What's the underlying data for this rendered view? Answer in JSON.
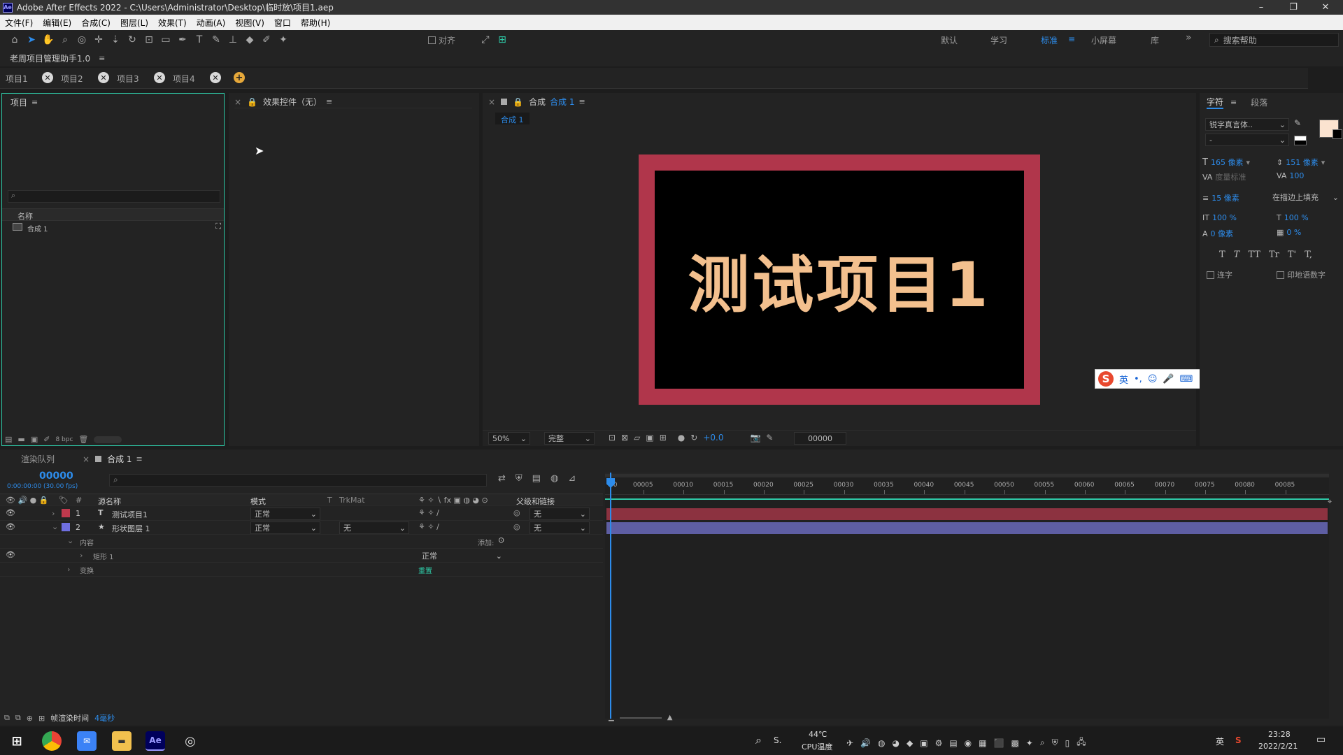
{
  "titlebar": {
    "logo": "Ae",
    "title": "Adobe After Effects 2022 - C:\\Users\\Administrator\\Desktop\\临时放\\项目1.aep",
    "minimize": "–",
    "restore": "❐",
    "close": "✕"
  },
  "menu": [
    "文件(F)",
    "编辑(E)",
    "合成(C)",
    "图层(L)",
    "效果(T)",
    "动画(A)",
    "视图(V)",
    "窗口",
    "帮助(H)"
  ],
  "toolbar": {
    "snap_label": "对齐",
    "workspaces": [
      "默认",
      "学习",
      "标准",
      "小屏幕",
      "库"
    ],
    "active_workspace": "标准",
    "search_placeholder": "搜索帮助",
    "more": "»"
  },
  "plugin": {
    "title": "老周项目管理助手1.0"
  },
  "project_tabs": [
    {
      "label": "项目1"
    },
    {
      "label": "项目2"
    },
    {
      "label": "项目3"
    },
    {
      "label": "项目4"
    }
  ],
  "project_panel": {
    "title": "项目",
    "column_name": "名称",
    "items": [
      {
        "name": "合成 1"
      }
    ],
    "bpc": "8 bpc"
  },
  "effects_panel": {
    "title": "效果控件（无）"
  },
  "comp_panel": {
    "title_prefix": "合成",
    "comp_name": "合成 1",
    "tab": "合成 1",
    "zoom": "50%",
    "quality": "完整",
    "exposure": "+0.0",
    "timecode": "00000"
  },
  "canvas": {
    "text": "测试项目1",
    "frame_color": "#b0364b",
    "text_color": "#f3c08e"
  },
  "ime": {
    "logo": "S",
    "items": [
      "英",
      "•,",
      "☺",
      "🎤",
      "⌨",
      "👤",
      "👕",
      "▦"
    ]
  },
  "char_panel": {
    "tab_char": "字符",
    "tab_para": "段落",
    "font": "锐字真言体..",
    "style": "-",
    "size": "165 像素",
    "leading": "151 像素",
    "kerning": "度量标准",
    "tracking": "100",
    "stroke": "15 像素",
    "stroke_mode": "在描边上填充",
    "vscale": "100 %",
    "hscale": "100 %",
    "baseline": "0 像素",
    "tsume": "0 %",
    "styles": [
      "T",
      "T",
      "TT",
      "Tr",
      "T'",
      "T,"
    ],
    "ligatures": "连字",
    "hindi": "印地语数字"
  },
  "timeline": {
    "render_queue": "渲染队列",
    "comp_tab": "合成 1",
    "timecode": "00000",
    "timecode_sub": "0:00:00:00 (30.00 fps)",
    "headers": {
      "source": "源名称",
      "mode": "模式",
      "t": "T",
      "trkmat": "TrkMat",
      "parent": "父级和链接"
    },
    "layers": [
      {
        "num": "1",
        "type": "T",
        "name": "测试项目1",
        "mode": "正常",
        "trkmat": "",
        "parent": "无",
        "color": "#c0394d",
        "bar_color": "#8c3240"
      },
      {
        "num": "2",
        "type": "★",
        "name": "形状图层 1",
        "mode": "正常",
        "trkmat": "无",
        "parent": "无",
        "color": "#6f6fe0",
        "bar_color": "#5e5ea3"
      }
    ],
    "sub": {
      "content": "内容",
      "add": "添加:",
      "rect": "矩形 1",
      "rect_mode": "正常",
      "transform": "变换",
      "reset": "重置"
    },
    "ruler": [
      "00005",
      "00010",
      "00015",
      "00020",
      "00025",
      "00030",
      "00035",
      "00040",
      "00045",
      "00050",
      "00055",
      "00060",
      "00065",
      "00070",
      "00075",
      "00080",
      "00085"
    ],
    "ruler_start": "00",
    "footer": {
      "label": "帧渲染时间",
      "value": "4毫秒"
    }
  },
  "taskbar": {
    "search": "S.",
    "temp": "44℃",
    "temp_label": "CPU温度",
    "time": "23:28",
    "date": "2022/2/21",
    "lang": "英",
    "ae": "Ae"
  }
}
